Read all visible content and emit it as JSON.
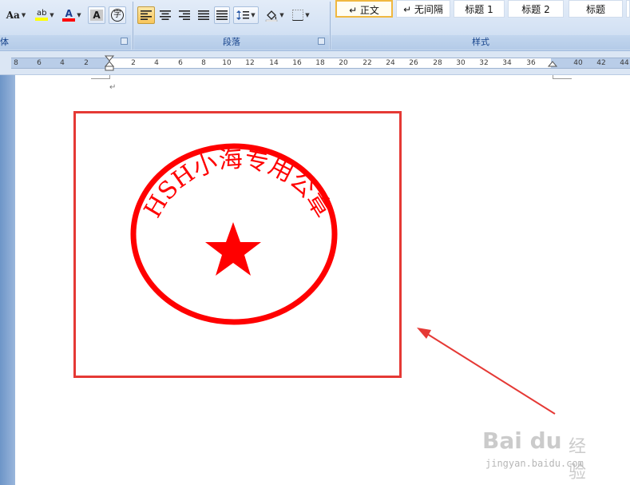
{
  "ribbon": {
    "font_group_label": "体",
    "paragraph_group_label": "段落",
    "styles_group_label": "样式",
    "font_tools": {
      "change_case": "Aa",
      "highlight": "ab",
      "font_color": "A",
      "char_shading": "A",
      "enclose_char": "字"
    },
    "styles": [
      "↵ 正文",
      "↵ 无间隔",
      "标题 1",
      "标题 2",
      "标题"
    ],
    "colors": {
      "highlight_yellow": "#ffff00",
      "font_color_red": "#ff0000"
    }
  },
  "ruler": {
    "ticks": [
      "8",
      "6",
      "4",
      "2",
      "2",
      "4",
      "6",
      "8",
      "10",
      "12",
      "14",
      "16",
      "18",
      "20",
      "22",
      "24",
      "26",
      "28",
      "30",
      "32",
      "34",
      "36",
      "40",
      "42",
      "44"
    ]
  },
  "document": {
    "paragraph_mark": "↵",
    "seal": {
      "text": "HSH小海专用公章",
      "color": "#ff0000",
      "shape": "ellipse-with-star"
    },
    "selection_box_color": "#e53935",
    "arrow_color": "#e53935"
  },
  "watermark": {
    "logo": "Bai du",
    "sub": "经验",
    "url": "jingyan.baidu.com"
  }
}
